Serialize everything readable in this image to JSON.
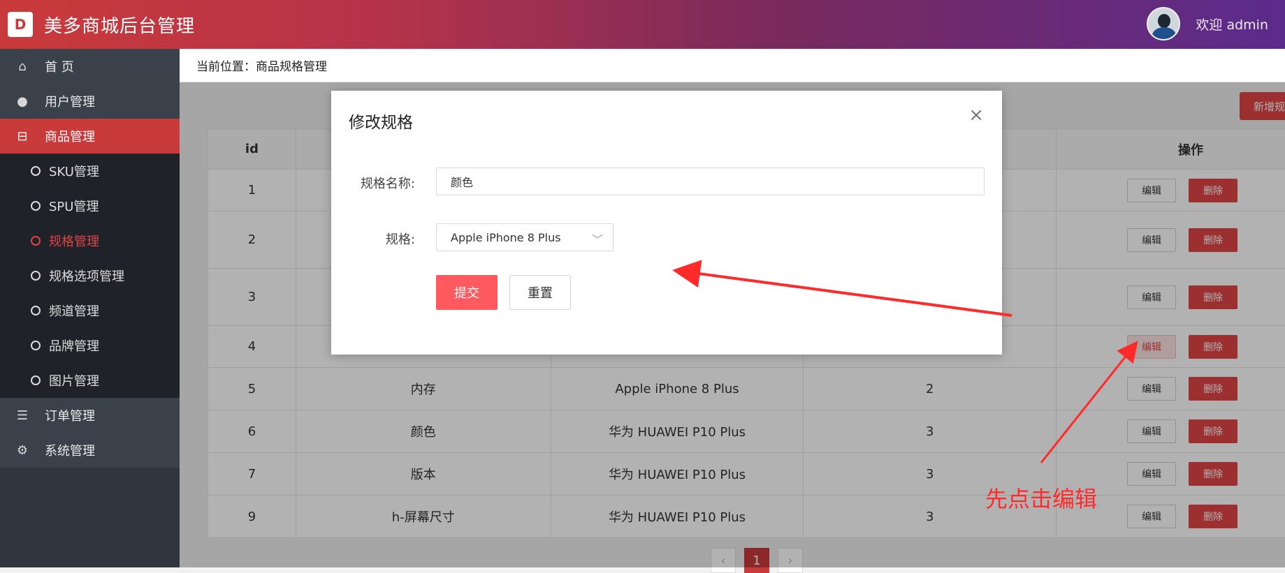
{
  "header": {
    "logo_text": "D",
    "title": "美多商城后台管理",
    "welcome": "欢迎 admin"
  },
  "sidebar": {
    "items": [
      {
        "label": "首 页",
        "icon": "home-icon"
      },
      {
        "label": "用户管理",
        "icon": "user-icon"
      },
      {
        "label": "商品管理",
        "icon": "basket-icon",
        "active": true
      },
      {
        "label": "订单管理",
        "icon": "list-icon"
      },
      {
        "label": "系统管理",
        "icon": "gear-icon"
      }
    ],
    "sub_items": [
      "SKU管理",
      "SPU管理",
      "规格管理",
      "规格选项管理",
      "频道管理",
      "品牌管理",
      "图片管理"
    ],
    "current_sub": "规格管理"
  },
  "breadcrumb": "当前位置：商品规格管理",
  "toolbar": {
    "add_label": "新增规格"
  },
  "table": {
    "headers": [
      "id",
      "",
      "",
      "",
      "操作"
    ],
    "rows": [
      {
        "id": "1",
        "name": "",
        "spu": "",
        "num": ""
      },
      {
        "id": "2",
        "name": "",
        "spu": "",
        "num": ""
      },
      {
        "id": "3",
        "name": "",
        "spu": "",
        "num": ""
      },
      {
        "id": "4",
        "name": "",
        "spu": "",
        "num": ""
      },
      {
        "id": "5",
        "name": "内存",
        "spu": "Apple iPhone 8 Plus",
        "num": "2"
      },
      {
        "id": "6",
        "name": "颜色",
        "spu": "华为 HUAWEI P10 Plus",
        "num": "3"
      },
      {
        "id": "7",
        "name": "版本",
        "spu": "华为 HUAWEI P10 Plus",
        "num": "3"
      },
      {
        "id": "9",
        "name": "h-屏幕尺寸",
        "spu": "华为 HUAWEI P10 Plus",
        "num": "3"
      }
    ],
    "edit_label": "编辑",
    "delete_label": "删除"
  },
  "pager": {
    "prev": "‹",
    "current": "1",
    "next": "›"
  },
  "modal": {
    "title": "修改规格",
    "close": "×",
    "name_label": "规格名称:",
    "name_value": "颜色",
    "spec_label": "规格:",
    "spec_value": "Apple iPhone 8 Plus",
    "submit_label": "提交",
    "reset_label": "重置"
  },
  "annotation": "先点击编辑",
  "colors": {
    "accent": "#c93a3a",
    "header_end": "#5b2b8c",
    "submit": "#ff5a5f",
    "annotation": "#ff2a2a"
  }
}
